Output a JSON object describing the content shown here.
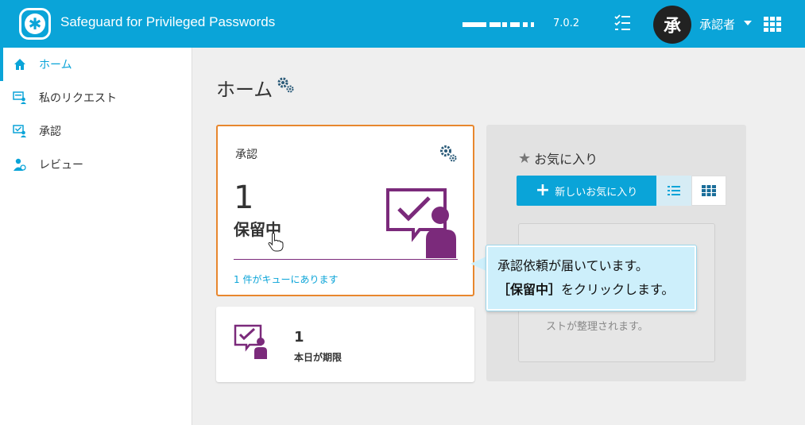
{
  "header": {
    "app_title": "Safeguard for Privileged Passwords",
    "version": "7.0.2",
    "avatar_initial": "承",
    "user_name": "承認者",
    "brand_color": "#0aa4d8"
  },
  "sidebar": {
    "items": [
      {
        "label": "ホーム",
        "icon": "home-icon",
        "active": true
      },
      {
        "label": "私のリクエスト",
        "icon": "my-requests-icon",
        "active": false
      },
      {
        "label": "承認",
        "icon": "approvals-icon",
        "active": false
      },
      {
        "label": "レビュー",
        "icon": "reviews-icon",
        "active": false
      }
    ]
  },
  "main": {
    "page_title": "ホーム",
    "approvals_card": {
      "title": "承認",
      "count": "1",
      "status": "保留中",
      "queue_link": "1 件がキューにあります"
    },
    "due_card": {
      "count": "1",
      "label": "本日が期限"
    },
    "favorites": {
      "title": "お気に入り",
      "new_button": "新しいお気に入り",
      "empty_text": "ストが整理されます。"
    }
  },
  "callout": {
    "line1": "承認依頼が届いています。",
    "line2_bold": "［保留中］",
    "line2_rest": "をクリックします。"
  },
  "colors": {
    "accent": "#0aa4d8",
    "card_highlight": "#e8872e",
    "purple": "#7b2a7b"
  }
}
